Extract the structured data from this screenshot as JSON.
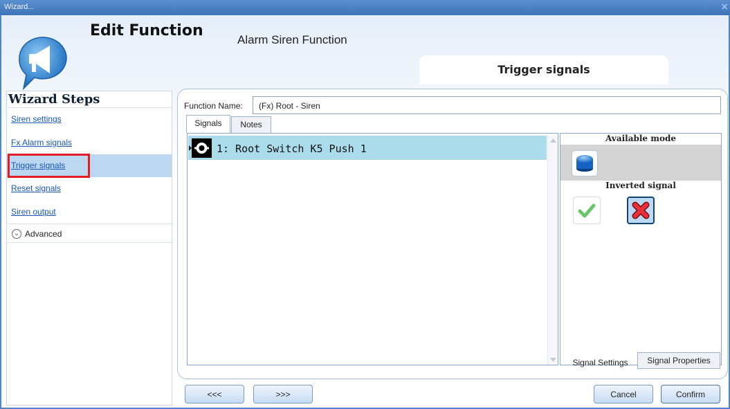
{
  "window": {
    "title": "Wizard...",
    "close_glyph": "×"
  },
  "header": {
    "title": "Edit Function",
    "subtitle": "Alarm Siren Function",
    "current_step_tab": "Trigger signals",
    "icon": "megaphone-chat-icon"
  },
  "wizard": {
    "heading": "Wizard Steps",
    "steps": [
      {
        "label": "Siren settings",
        "selected": false
      },
      {
        "label": "Fx Alarm signals",
        "selected": false
      },
      {
        "label": "Trigger signals",
        "selected": true
      },
      {
        "label": "Reset signals",
        "selected": false
      },
      {
        "label": "Siren output",
        "selected": false
      }
    ],
    "advanced": {
      "label": "Advanced",
      "icon": "chevron-down-icon"
    }
  },
  "function_name": {
    "label": "Function Name:",
    "value": "(Fx) Root - Siren"
  },
  "tabs": [
    {
      "label": "Signals",
      "active": true
    },
    {
      "label": "Notes",
      "active": false
    }
  ],
  "signals": [
    {
      "label": "1: Root Switch K5 Push 1",
      "icon": "push-button-contact-icon",
      "selected": true
    }
  ],
  "signal_settings": {
    "available_mode_label": "Available mode",
    "available_mode_icon": "blue-push-button-icon",
    "inverted_signal_label": "Inverted signal",
    "inverted_options": [
      {
        "icon": "check-icon",
        "selected": false
      },
      {
        "icon": "red-x-icon",
        "selected": true
      }
    ],
    "bottom_tabs": [
      {
        "label": "Signal Settings",
        "active": true
      },
      {
        "label": "Signal Properties",
        "active": false
      }
    ]
  },
  "footer": {
    "back_label": "<<<",
    "next_label": ">>>",
    "cancel_label": "Cancel",
    "confirm_label": "Confirm"
  },
  "colors": {
    "titlebar": "#4a7fc4",
    "selected_step": "#bcd7f0",
    "highlight_row": "#abdcec",
    "red_box": "#e31b23",
    "link": "#1657b7"
  }
}
